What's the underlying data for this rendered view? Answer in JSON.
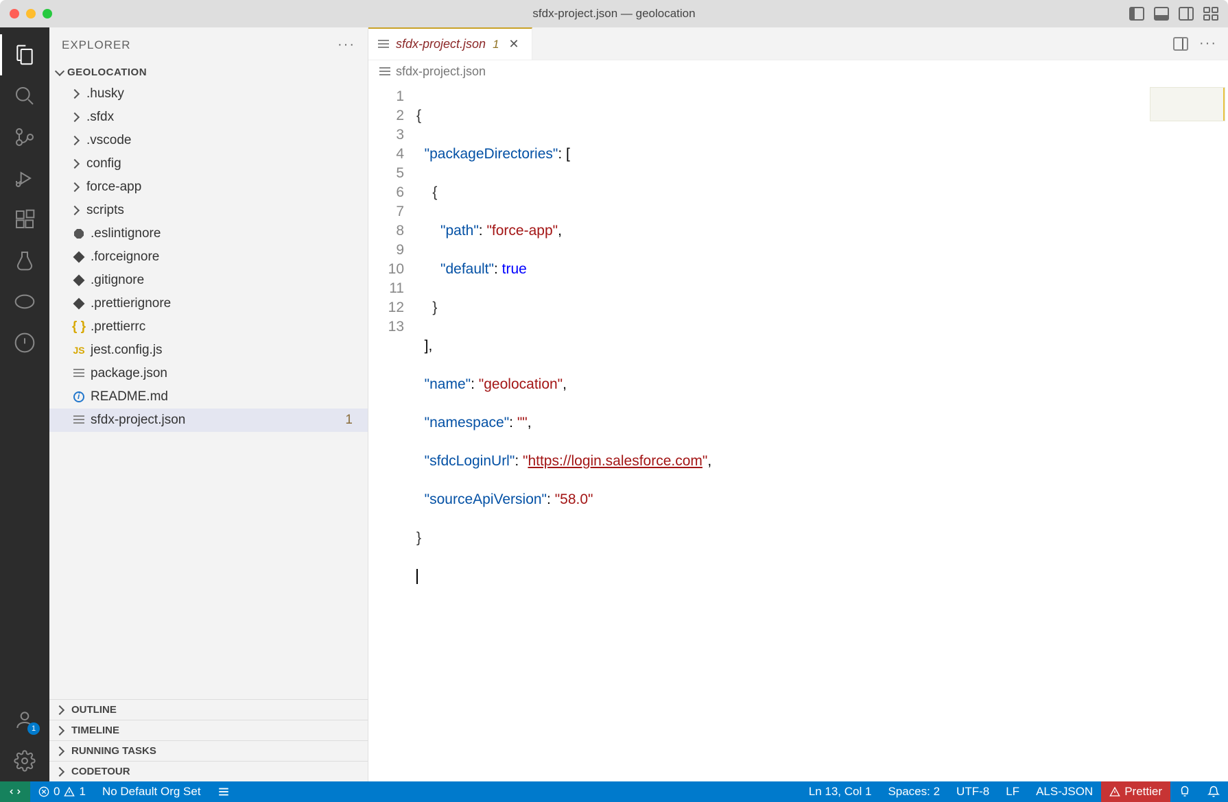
{
  "window": {
    "title": "sfdx-project.json — geolocation"
  },
  "activity": {
    "account_badge": "1"
  },
  "sidebar": {
    "header": "EXPLORER",
    "project": "GEOLOCATION",
    "tree": [
      {
        "name": ".husky",
        "type": "folder"
      },
      {
        "name": ".sfdx",
        "type": "folder"
      },
      {
        "name": ".vscode",
        "type": "folder"
      },
      {
        "name": "config",
        "type": "folder"
      },
      {
        "name": "force-app",
        "type": "folder"
      },
      {
        "name": "scripts",
        "type": "folder"
      },
      {
        "name": ".eslintignore",
        "type": "file",
        "icon": "stop"
      },
      {
        "name": ".forceignore",
        "type": "file",
        "icon": "diamond"
      },
      {
        "name": ".gitignore",
        "type": "file",
        "icon": "diamond"
      },
      {
        "name": ".prettierignore",
        "type": "file",
        "icon": "diamond"
      },
      {
        "name": ".prettierrc",
        "type": "file",
        "icon": "json"
      },
      {
        "name": "jest.config.js",
        "type": "file",
        "icon": "js"
      },
      {
        "name": "package.json",
        "type": "file",
        "icon": "lines"
      },
      {
        "name": "README.md",
        "type": "file",
        "icon": "info"
      },
      {
        "name": "sfdx-project.json",
        "type": "file",
        "icon": "lines",
        "active": true,
        "badge": "1"
      }
    ],
    "collapsed": [
      "OUTLINE",
      "TIMELINE",
      "RUNNING TASKS",
      "CODETOUR"
    ]
  },
  "editor": {
    "tab": {
      "filename": "sfdx-project.json",
      "modified_indicator": "1"
    },
    "breadcrumb": "sfdx-project.json",
    "lines": [
      "1",
      "2",
      "3",
      "4",
      "5",
      "6",
      "7",
      "8",
      "9",
      "10",
      "11",
      "12",
      "13"
    ],
    "code": {
      "packageDirectories_key": "\"packageDirectories\"",
      "path_key": "\"path\"",
      "path_val": "\"force-app\"",
      "default_key": "\"default\"",
      "default_val": "true",
      "name_key": "\"name\"",
      "name_val": "\"geolocation\"",
      "namespace_key": "\"namespace\"",
      "namespace_val": "\"\"",
      "sfdc_key": "\"sfdcLoginUrl\"",
      "sfdc_val": "https://login.salesforce.com",
      "src_key": "\"sourceApiVersion\"",
      "src_val": "\"58.0\""
    }
  },
  "statusbar": {
    "errors": "0",
    "warnings": "1",
    "org": "No Default Org Set",
    "cursor": "Ln 13, Col 1",
    "spaces": "Spaces: 2",
    "encoding": "UTF-8",
    "eol": "LF",
    "lang": "ALS-JSON",
    "prettier": "Prettier"
  }
}
